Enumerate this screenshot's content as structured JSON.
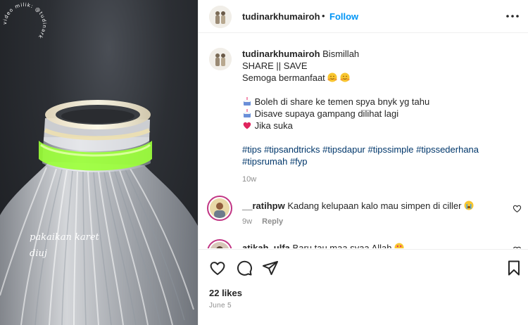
{
  "post": {
    "username": "tudinarkhumairoh",
    "follow_label": "Follow",
    "separator": "•",
    "media": {
      "caption_line1": "pakaikan karet",
      "caption_line2": "diuj",
      "watermark_text": "video milik: @tudinark"
    }
  },
  "caption": {
    "username": "tudinarkhumairoh",
    "first_line": "Bismillah",
    "line2": "SHARE || SAVE",
    "line3": "Semoga bermanfaat",
    "list": [
      "Boleh di share ke temen spya bnyk yg tahu",
      "Disave supaya gampang dilihat lagi",
      "Jika suka"
    ],
    "hashtags_line1": "#tips #tipsandtricks #tipsdapur #tipssimple #tipssederhana",
    "hashtags_line2": "#tipsrumah #fyp",
    "time": "10w"
  },
  "comments": [
    {
      "username": "__ratihpw",
      "text": "Kadang kelupaan kalo mau simpen di ciller",
      "time": "9w",
      "reply_label": "Reply"
    },
    {
      "username": "atikah_ulfa",
      "text": "Baru tau maa syaa Allah"
    }
  ],
  "footer": {
    "likes": "22 likes",
    "date": "June 5"
  },
  "icons": {
    "like": "heart-icon",
    "comment": "comment-icon",
    "share": "share-icon",
    "save": "bookmark-icon",
    "more": "more-options-icon"
  },
  "colors": {
    "link": "#0095f6",
    "hashtag": "#00376b",
    "muted": "#8e8e8e",
    "story_ring": "#c13584"
  }
}
